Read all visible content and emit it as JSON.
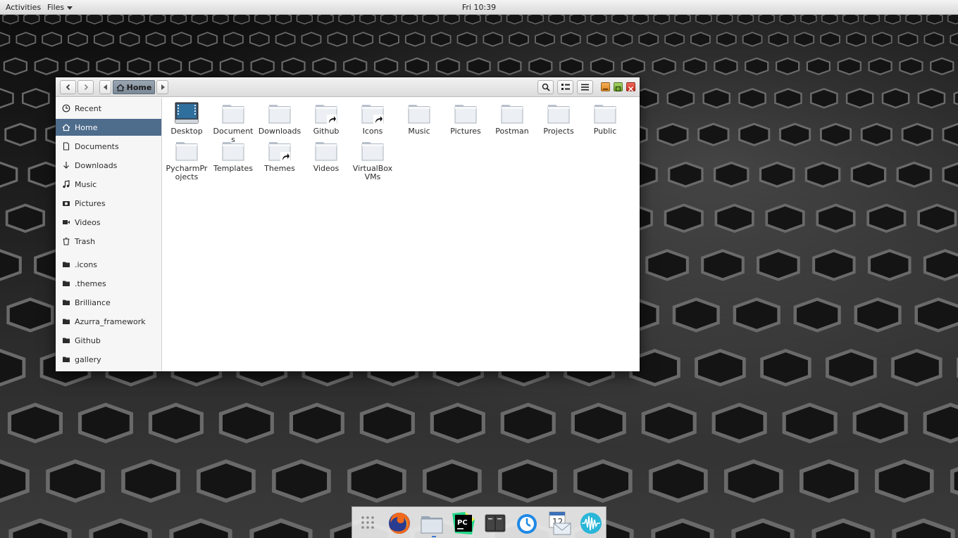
{
  "topbar": {
    "activities": "Activities",
    "app_menu": "Files",
    "clock": "Fri 10:39"
  },
  "window": {
    "breadcrumb_current": "Home",
    "buttons": [
      "back",
      "forward",
      "path-left",
      "path-right",
      "search",
      "view-list",
      "menu"
    ]
  },
  "sidebar": {
    "places": [
      {
        "label": "Recent",
        "icon": "clock-icon",
        "active": false
      },
      {
        "label": "Home",
        "icon": "home-icon",
        "active": true
      },
      {
        "label": "Documents",
        "icon": "document-icon",
        "active": false
      },
      {
        "label": "Downloads",
        "icon": "download-icon",
        "active": false
      },
      {
        "label": "Music",
        "icon": "music-icon",
        "active": false
      },
      {
        "label": "Pictures",
        "icon": "camera-icon",
        "active": false
      },
      {
        "label": "Videos",
        "icon": "video-icon",
        "active": false
      },
      {
        "label": "Trash",
        "icon": "trash-icon",
        "active": false
      }
    ],
    "bookmarks": [
      {
        "label": ".icons",
        "icon": "folder-icon"
      },
      {
        "label": ".themes",
        "icon": "folder-icon"
      },
      {
        "label": "Brilliance",
        "icon": "folder-icon"
      },
      {
        "label": "Azurra_framework",
        "icon": "folder-icon"
      },
      {
        "label": "Github",
        "icon": "folder-icon"
      },
      {
        "label": "gallery",
        "icon": "folder-icon"
      }
    ]
  },
  "files": [
    {
      "name": "Desktop",
      "kind": "desktop"
    },
    {
      "name": "Documents",
      "kind": "folder"
    },
    {
      "name": "Downloads",
      "kind": "folder"
    },
    {
      "name": "Github",
      "kind": "link"
    },
    {
      "name": "Icons",
      "kind": "link"
    },
    {
      "name": "Music",
      "kind": "folder"
    },
    {
      "name": "Pictures",
      "kind": "folder"
    },
    {
      "name": "Postman",
      "kind": "folder"
    },
    {
      "name": "Projects",
      "kind": "folder"
    },
    {
      "name": "Public",
      "kind": "folder"
    },
    {
      "name": "PycharmProjects",
      "kind": "folder"
    },
    {
      "name": "Templates",
      "kind": "folder"
    },
    {
      "name": "Themes",
      "kind": "link"
    },
    {
      "name": "Videos",
      "kind": "folder"
    },
    {
      "name": "VirtualBox VMs",
      "kind": "folder"
    }
  ],
  "dock": {
    "items": [
      "apps-grid-icon",
      "firefox-icon",
      "files-icon",
      "pycharm-icon",
      "terminal-icon",
      "timer-icon",
      "mail-calendar-icon",
      "audio-icon"
    ],
    "calendar_day": "12"
  },
  "colors": {
    "sidebar_active": "#4e6c8c",
    "close": "#c8281a",
    "maximize": "#6fa32a",
    "minimize": "#d9801c"
  }
}
